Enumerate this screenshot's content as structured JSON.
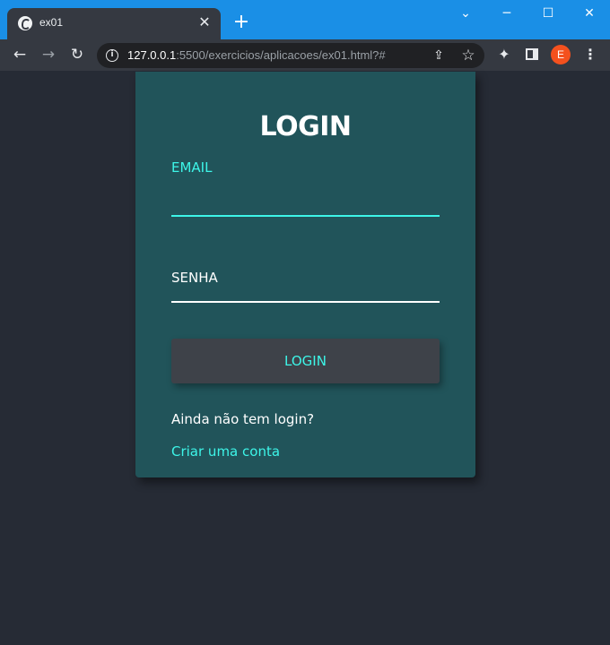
{
  "browser": {
    "tab_title": "ex01",
    "tab_close": "✕",
    "new_tab": "+",
    "url_host": "127.0.0.1",
    "url_path": ":5500/exercicios/aplicacoes/ex01.html?#",
    "profile_initial": "E",
    "accent": "#1a8fe6"
  },
  "login": {
    "title": "LOGIN",
    "email_label": "EMAIL",
    "email_value": "",
    "password_label": "SENHA",
    "password_value": "",
    "button_label": "LOGIN",
    "prompt": "Ainda não tem login?",
    "signup_link": "Criar uma conta",
    "colors": {
      "card": "#21545a",
      "accent": "#3df5e8",
      "page_bg": "#262b35",
      "button_bg": "#3e4249"
    }
  }
}
